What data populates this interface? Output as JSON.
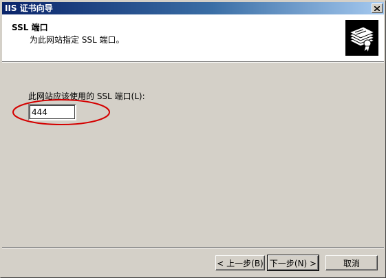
{
  "window": {
    "title": "IIS 证书向导"
  },
  "header": {
    "title": "SSL 端口",
    "subtitle": "为此网站指定 SSL 端口。"
  },
  "form": {
    "port_label": "此网站应该使用的 SSL 端口(L):",
    "port_value": "444"
  },
  "buttons": {
    "back": "< 上一步(B)",
    "next": "下一步(N) >",
    "cancel": "取消"
  },
  "colors": {
    "titlebar_start": "#0a246a",
    "titlebar_end": "#a6caf0",
    "highlight": "#d40000",
    "dialog_bg": "#d4d0c8"
  }
}
